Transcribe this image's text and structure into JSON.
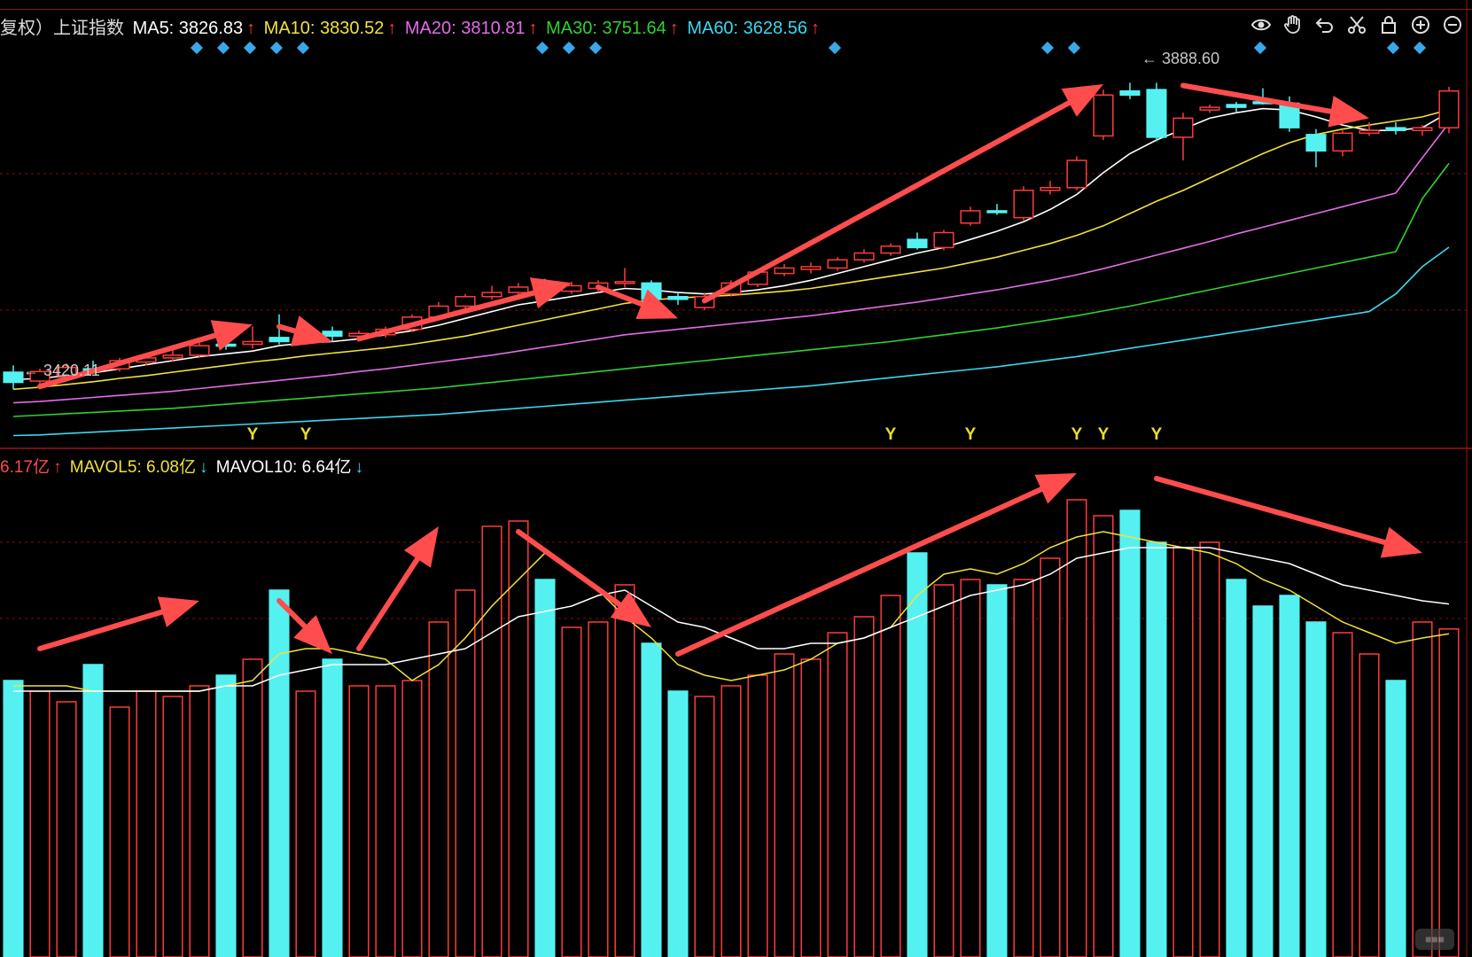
{
  "price_header": {
    "prefix": "复权）上证指数",
    "ma5": {
      "label": "MA5: 3826.83",
      "arrow": "↑",
      "color": "#ffffff"
    },
    "ma10": {
      "label": "MA10: 3830.52",
      "arrow": "↑",
      "color": "#f0e23a"
    },
    "ma20": {
      "label": "MA20: 3810.81",
      "arrow": "↑",
      "color": "#e26ce6"
    },
    "ma30": {
      "label": "MA30: 3751.64",
      "arrow": "↑",
      "color": "#2fd22f"
    },
    "ma60": {
      "label": "MA60: 3628.56",
      "arrow": "↑",
      "color": "#3ad8f0"
    }
  },
  "volume_header": {
    "vol": {
      "label": "6.17亿",
      "arrow": "↑",
      "color": "#ff4a4a"
    },
    "mavol5": {
      "label": "MAVOL5: 6.08亿",
      "arrow": "↓",
      "color": "#f0e23a"
    },
    "mavol10": {
      "label": "MAVOL10: 6.64亿",
      "arrow": "↓",
      "color": "#ffffff"
    }
  },
  "toolbar": {
    "icons": [
      "eye-icon",
      "hand-icon",
      "undo-icon",
      "scissors-icon",
      "lock-icon",
      "zoom-in-icon",
      "zoom-out-icon"
    ]
  },
  "price_labels": {
    "high": "3888.60",
    "low": "3420.11"
  },
  "signal_marker": "Y",
  "colors": {
    "up": "#ff3b3b",
    "down": "#55f1f1",
    "grid": "#7a1010",
    "arrow": "#ff4d4d",
    "background": "#000000"
  },
  "chart_data": {
    "type": "candlestick",
    "ylim": [
      3380,
      3920
    ],
    "candles": [
      {
        "o": 3430,
        "h": 3455,
        "l": 3420,
        "c": 3445,
        "dir": "down"
      },
      {
        "o": 3432,
        "h": 3450,
        "l": 3425,
        "c": 3446,
        "dir": "up"
      },
      {
        "o": 3440,
        "h": 3458,
        "l": 3435,
        "c": 3452,
        "dir": "up"
      },
      {
        "o": 3449,
        "h": 3462,
        "l": 3444,
        "c": 3450,
        "dir": "down"
      },
      {
        "o": 3450,
        "h": 3466,
        "l": 3446,
        "c": 3462,
        "dir": "up"
      },
      {
        "o": 3460,
        "h": 3470,
        "l": 3455,
        "c": 3466,
        "dir": "up"
      },
      {
        "o": 3466,
        "h": 3478,
        "l": 3460,
        "c": 3470,
        "dir": "up"
      },
      {
        "o": 3470,
        "h": 3488,
        "l": 3466,
        "c": 3484,
        "dir": "up"
      },
      {
        "o": 3484,
        "h": 3498,
        "l": 3478,
        "c": 3486,
        "dir": "down"
      },
      {
        "o": 3486,
        "h": 3512,
        "l": 3480,
        "c": 3490,
        "dir": "up"
      },
      {
        "o": 3490,
        "h": 3530,
        "l": 3486,
        "c": 3496,
        "dir": "down"
      },
      {
        "o": 3496,
        "h": 3510,
        "l": 3490,
        "c": 3505,
        "dir": "up"
      },
      {
        "o": 3505,
        "h": 3512,
        "l": 3490,
        "c": 3498,
        "dir": "down"
      },
      {
        "o": 3498,
        "h": 3506,
        "l": 3492,
        "c": 3502,
        "dir": "up"
      },
      {
        "o": 3500,
        "h": 3512,
        "l": 3496,
        "c": 3508,
        "dir": "up"
      },
      {
        "o": 3508,
        "h": 3530,
        "l": 3504,
        "c": 3526,
        "dir": "up"
      },
      {
        "o": 3526,
        "h": 3548,
        "l": 3522,
        "c": 3542,
        "dir": "up"
      },
      {
        "o": 3542,
        "h": 3560,
        "l": 3538,
        "c": 3556,
        "dir": "up"
      },
      {
        "o": 3556,
        "h": 3572,
        "l": 3552,
        "c": 3562,
        "dir": "up"
      },
      {
        "o": 3562,
        "h": 3576,
        "l": 3558,
        "c": 3570,
        "dir": "up"
      },
      {
        "o": 3570,
        "h": 3582,
        "l": 3560,
        "c": 3564,
        "dir": "down"
      },
      {
        "o": 3564,
        "h": 3578,
        "l": 3560,
        "c": 3572,
        "dir": "up"
      },
      {
        "o": 3568,
        "h": 3580,
        "l": 3562,
        "c": 3576,
        "dir": "up"
      },
      {
        "o": 3576,
        "h": 3598,
        "l": 3570,
        "c": 3578,
        "dir": "up"
      },
      {
        "o": 3576,
        "h": 3580,
        "l": 3548,
        "c": 3552,
        "dir": "down"
      },
      {
        "o": 3552,
        "h": 3562,
        "l": 3544,
        "c": 3556,
        "dir": "down"
      },
      {
        "o": 3540,
        "h": 3562,
        "l": 3536,
        "c": 3556,
        "dir": "up"
      },
      {
        "o": 3560,
        "h": 3580,
        "l": 3556,
        "c": 3576,
        "dir": "up"
      },
      {
        "o": 3574,
        "h": 3596,
        "l": 3570,
        "c": 3592,
        "dir": "up"
      },
      {
        "o": 3590,
        "h": 3604,
        "l": 3586,
        "c": 3598,
        "dir": "up"
      },
      {
        "o": 3596,
        "h": 3606,
        "l": 3590,
        "c": 3600,
        "dir": "up"
      },
      {
        "o": 3598,
        "h": 3614,
        "l": 3594,
        "c": 3610,
        "dir": "up"
      },
      {
        "o": 3610,
        "h": 3626,
        "l": 3606,
        "c": 3620,
        "dir": "up"
      },
      {
        "o": 3620,
        "h": 3634,
        "l": 3616,
        "c": 3630,
        "dir": "up"
      },
      {
        "o": 3640,
        "h": 3650,
        "l": 3625,
        "c": 3628,
        "dir": "down"
      },
      {
        "o": 3628,
        "h": 3654,
        "l": 3624,
        "c": 3650,
        "dir": "up"
      },
      {
        "o": 3664,
        "h": 3688,
        "l": 3660,
        "c": 3682,
        "dir": "up"
      },
      {
        "o": 3680,
        "h": 3692,
        "l": 3676,
        "c": 3682,
        "dir": "down"
      },
      {
        "o": 3672,
        "h": 3718,
        "l": 3668,
        "c": 3712,
        "dir": "up"
      },
      {
        "o": 3712,
        "h": 3726,
        "l": 3706,
        "c": 3716,
        "dir": "up"
      },
      {
        "o": 3716,
        "h": 3762,
        "l": 3712,
        "c": 3756,
        "dir": "up"
      },
      {
        "o": 3792,
        "h": 3860,
        "l": 3786,
        "c": 3852,
        "dir": "up"
      },
      {
        "o": 3852,
        "h": 3870,
        "l": 3846,
        "c": 3858,
        "dir": "down"
      },
      {
        "o": 3860,
        "h": 3870,
        "l": 3784,
        "c": 3790,
        "dir": "down"
      },
      {
        "o": 3790,
        "h": 3826,
        "l": 3756,
        "c": 3818,
        "dir": "up"
      },
      {
        "o": 3830,
        "h": 3838,
        "l": 3826,
        "c": 3834,
        "dir": "up"
      },
      {
        "o": 3834,
        "h": 3842,
        "l": 3826,
        "c": 3838,
        "dir": "down"
      },
      {
        "o": 3842,
        "h": 3862,
        "l": 3838,
        "c": 3840,
        "dir": "down"
      },
      {
        "o": 3840,
        "h": 3850,
        "l": 3798,
        "c": 3804,
        "dir": "down"
      },
      {
        "o": 3794,
        "h": 3802,
        "l": 3746,
        "c": 3770,
        "dir": "down"
      },
      {
        "o": 3770,
        "h": 3800,
        "l": 3762,
        "c": 3796,
        "dir": "up"
      },
      {
        "o": 3796,
        "h": 3812,
        "l": 3792,
        "c": 3800,
        "dir": "up"
      },
      {
        "o": 3800,
        "h": 3812,
        "l": 3794,
        "c": 3804,
        "dir": "down"
      },
      {
        "o": 3800,
        "h": 3808,
        "l": 3792,
        "c": 3804,
        "dir": "up"
      },
      {
        "o": 3804,
        "h": 3864,
        "l": 3796,
        "c": 3858,
        "dir": "up"
      }
    ],
    "ma_lines": [
      {
        "name": "MA5",
        "color": "#ffffff",
        "values": [
          3434,
          3436,
          3440,
          3444,
          3450,
          3456,
          3462,
          3468,
          3472,
          3476,
          3484,
          3488,
          3490,
          3494,
          3500,
          3506,
          3514,
          3524,
          3534,
          3544,
          3550,
          3556,
          3562,
          3568,
          3566,
          3562,
          3560,
          3562,
          3566,
          3572,
          3580,
          3590,
          3600,
          3610,
          3620,
          3628,
          3640,
          3652,
          3666,
          3684,
          3706,
          3738,
          3766,
          3786,
          3802,
          3818,
          3826,
          3832,
          3830,
          3820,
          3808,
          3800,
          3800,
          3804,
          3826.83
        ]
      },
      {
        "name": "MA10",
        "color": "#f0e23a",
        "values": [
          3420,
          3423,
          3427,
          3431,
          3436,
          3440,
          3445,
          3450,
          3455,
          3460,
          3464,
          3469,
          3473,
          3477,
          3481,
          3486,
          3492,
          3498,
          3506,
          3514,
          3522,
          3530,
          3538,
          3546,
          3551,
          3554,
          3556,
          3558,
          3561,
          3564,
          3568,
          3574,
          3580,
          3586,
          3592,
          3598,
          3606,
          3614,
          3624,
          3634,
          3646,
          3660,
          3678,
          3696,
          3712,
          3730,
          3748,
          3766,
          3782,
          3794,
          3802,
          3808,
          3814,
          3820,
          3830.52
        ]
      },
      {
        "name": "MA20",
        "color": "#e26ce6",
        "values": [
          3400,
          3402,
          3405,
          3408,
          3411,
          3414,
          3417,
          3421,
          3425,
          3429,
          3433,
          3437,
          3441,
          3446,
          3450,
          3455,
          3460,
          3465,
          3470,
          3476,
          3482,
          3488,
          3494,
          3500,
          3504,
          3508,
          3512,
          3516,
          3520,
          3524,
          3528,
          3533,
          3538,
          3543,
          3548,
          3554,
          3560,
          3566,
          3573,
          3580,
          3588,
          3597,
          3607,
          3617,
          3627,
          3637,
          3648,
          3658,
          3668,
          3678,
          3688,
          3698,
          3708,
          3760,
          3810.81
        ]
      },
      {
        "name": "MA30",
        "color": "#2fd22f",
        "values": [
          3380,
          3382,
          3384,
          3386,
          3388,
          3390,
          3392,
          3395,
          3398,
          3401,
          3404,
          3407,
          3410,
          3413,
          3416,
          3419,
          3422,
          3426,
          3430,
          3434,
          3438,
          3442,
          3446,
          3450,
          3454,
          3458,
          3462,
          3466,
          3470,
          3474,
          3478,
          3482,
          3486,
          3490,
          3495,
          3500,
          3505,
          3510,
          3516,
          3522,
          3528,
          3535,
          3542,
          3550,
          3558,
          3566,
          3574,
          3582,
          3590,
          3598,
          3606,
          3614,
          3622,
          3700,
          3751.64
        ]
      },
      {
        "name": "MA60",
        "color": "#3ad8f0",
        "values": [
          3352,
          3353,
          3355,
          3357,
          3359,
          3361,
          3363,
          3365,
          3367,
          3369,
          3371,
          3373,
          3375,
          3377,
          3379,
          3381,
          3383,
          3386,
          3389,
          3392,
          3395,
          3398,
          3401,
          3404,
          3407,
          3410,
          3413,
          3416,
          3419,
          3422,
          3425,
          3429,
          3433,
          3437,
          3441,
          3445,
          3449,
          3453,
          3458,
          3463,
          3468,
          3474,
          3480,
          3486,
          3492,
          3498,
          3504,
          3510,
          3516,
          3522,
          3528,
          3534,
          3560,
          3600,
          3628.56
        ]
      }
    ],
    "volume": [
      5.2,
      5.0,
      4.8,
      5.5,
      4.7,
      5.0,
      4.9,
      5.1,
      5.3,
      5.6,
      6.9,
      5.0,
      5.6,
      5.1,
      5.1,
      5.2,
      6.3,
      6.9,
      8.1,
      8.2,
      7.1,
      6.2,
      6.3,
      7.0,
      5.9,
      5.0,
      4.9,
      5.1,
      5.3,
      5.7,
      5.6,
      6.1,
      6.4,
      6.8,
      7.6,
      7.0,
      7.1,
      7.0,
      7.1,
      7.5,
      8.6,
      8.3,
      8.4,
      7.8,
      7.7,
      7.8,
      7.1,
      6.6,
      6.8,
      6.3,
      6.1,
      5.7,
      5.2,
      6.3,
      6.17
    ],
    "mavol5": [
      5.1,
      5.1,
      5.1,
      5.0,
      5.0,
      5.0,
      5.0,
      5.0,
      5.1,
      5.2,
      5.7,
      5.8,
      5.8,
      5.7,
      5.6,
      5.2,
      5.5,
      6.0,
      6.6,
      7.1,
      7.6,
      7.3,
      6.9,
      6.4,
      6.0,
      5.5,
      5.3,
      5.2,
      5.3,
      5.4,
      5.6,
      5.9,
      6.0,
      6.2,
      6.8,
      7.2,
      7.3,
      7.2,
      7.4,
      7.7,
      7.9,
      8.0,
      7.9,
      7.8,
      7.7,
      7.6,
      7.4,
      7.1,
      6.9,
      6.6,
      6.3,
      6.1,
      5.9,
      6.0,
      6.08
    ],
    "mavol10": [
      5.0,
      5.0,
      5.0,
      5.0,
      5.0,
      5.0,
      5.0,
      5.0,
      5.1,
      5.1,
      5.3,
      5.4,
      5.5,
      5.5,
      5.5,
      5.6,
      5.7,
      5.8,
      6.1,
      6.4,
      6.5,
      6.6,
      6.8,
      6.9,
      6.6,
      6.3,
      6.2,
      6.0,
      5.8,
      5.8,
      5.9,
      5.9,
      6.0,
      6.2,
      6.4,
      6.6,
      6.8,
      6.9,
      7.0,
      7.2,
      7.5,
      7.6,
      7.7,
      7.7,
      7.7,
      7.7,
      7.6,
      7.5,
      7.4,
      7.2,
      7.0,
      6.9,
      6.8,
      6.7,
      6.64
    ],
    "volume_ylim": [
      0,
      9
    ],
    "y_signals_at": [
      9,
      11,
      33,
      36,
      40,
      41,
      43
    ],
    "diamond_markers_at": [
      7,
      8,
      9,
      10,
      11,
      20,
      21,
      22,
      31,
      39,
      40,
      47,
      52,
      53
    ],
    "arrow_annotations": [
      {
        "from": [
          1,
          3424
        ],
        "to": [
          9,
          3515
        ],
        "panel": "price"
      },
      {
        "from": [
          10,
          3512
        ],
        "to": [
          12,
          3490
        ],
        "panel": "price"
      },
      {
        "from": [
          13,
          3494
        ],
        "to": [
          21,
          3576
        ],
        "panel": "price"
      },
      {
        "from": [
          22,
          3570
        ],
        "to": [
          25,
          3524
        ],
        "panel": "price"
      },
      {
        "from": [
          26,
          3550
        ],
        "to": [
          41,
          3868
        ],
        "panel": "price"
      },
      {
        "from": [
          44,
          3866
        ],
        "to": [
          51,
          3818
        ],
        "panel": "price"
      },
      {
        "from": [
          1,
          5.8
        ],
        "to": [
          7,
          6.7
        ],
        "panel": "volume"
      },
      {
        "from": [
          10,
          6.7
        ],
        "to": [
          12,
          5.7
        ],
        "panel": "volume"
      },
      {
        "from": [
          13,
          5.8
        ],
        "to": [
          16,
          8.1
        ],
        "panel": "volume"
      },
      {
        "from": [
          19,
          8.0
        ],
        "to": [
          24,
          6.2
        ],
        "panel": "volume"
      },
      {
        "from": [
          25,
          5.7
        ],
        "to": [
          40,
          9.1
        ],
        "panel": "volume"
      },
      {
        "from": [
          43,
          9.0
        ],
        "to": [
          53,
          7.6
        ],
        "panel": "volume"
      }
    ]
  }
}
